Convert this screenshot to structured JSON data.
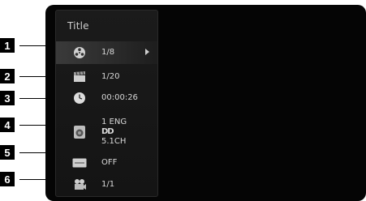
{
  "menu": {
    "title": "Title",
    "rows": [
      {
        "icon": "disc-reel-icon",
        "value": "1/8",
        "selected": true
      },
      {
        "icon": "clapperboard-icon",
        "value": "1/20"
      },
      {
        "icon": "clock-icon",
        "value": "00:00:26"
      },
      {
        "icon": "speaker-icon",
        "lines": [
          "1 ENG",
          "DD",
          "5.1CH"
        ]
      },
      {
        "icon": "subtitle-abc-icon",
        "value": "OFF"
      },
      {
        "icon": "camera-angle-icon",
        "value": "1/1"
      }
    ]
  },
  "callouts": [
    "1",
    "2",
    "3",
    "4",
    "5",
    "6"
  ],
  "colors": {
    "screen": "#050505",
    "panel": "#181818",
    "text": "#d8d8d8",
    "callout_bg": "#000000"
  }
}
